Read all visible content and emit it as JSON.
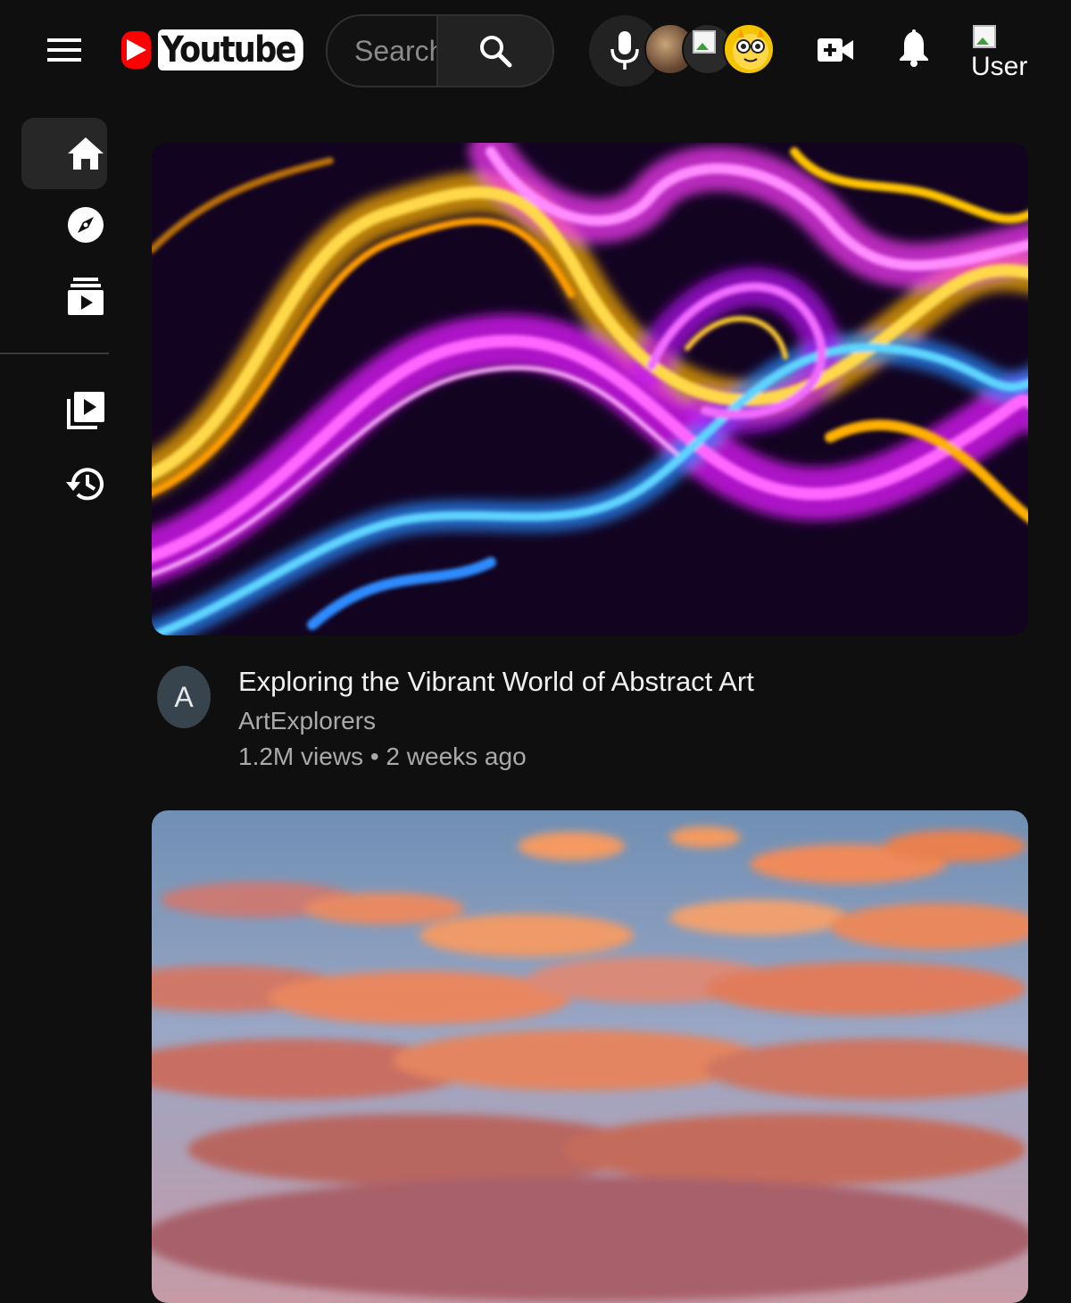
{
  "header": {
    "logo_text": "Youtube",
    "search_placeholder": "Search",
    "user_avatar_alt": "User"
  },
  "feed": {
    "videos": [
      {
        "title": "Exploring the Vibrant World of Abstract Art",
        "channel": "ArtExplorers",
        "channel_initial": "A",
        "views": "1.2M views",
        "separator": "•",
        "age": "2 weeks ago"
      },
      {
        "title": "",
        "channel": "",
        "views": "",
        "age": ""
      }
    ]
  },
  "colors": {
    "background": "#0f0f0f",
    "brand_red": "#ff0000",
    "text_primary": "#f1f1f1",
    "text_secondary": "#aaaaaa",
    "surface": "#272727"
  },
  "icons": {
    "menu": "hamburger-menu-icon",
    "search": "search-icon",
    "mic": "microphone-icon",
    "create": "video-camera-plus-icon",
    "notifications": "bell-icon",
    "home": "home-icon",
    "explore": "compass-icon",
    "subscriptions": "subscriptions-icon",
    "library": "library-icon",
    "history": "history-icon"
  }
}
